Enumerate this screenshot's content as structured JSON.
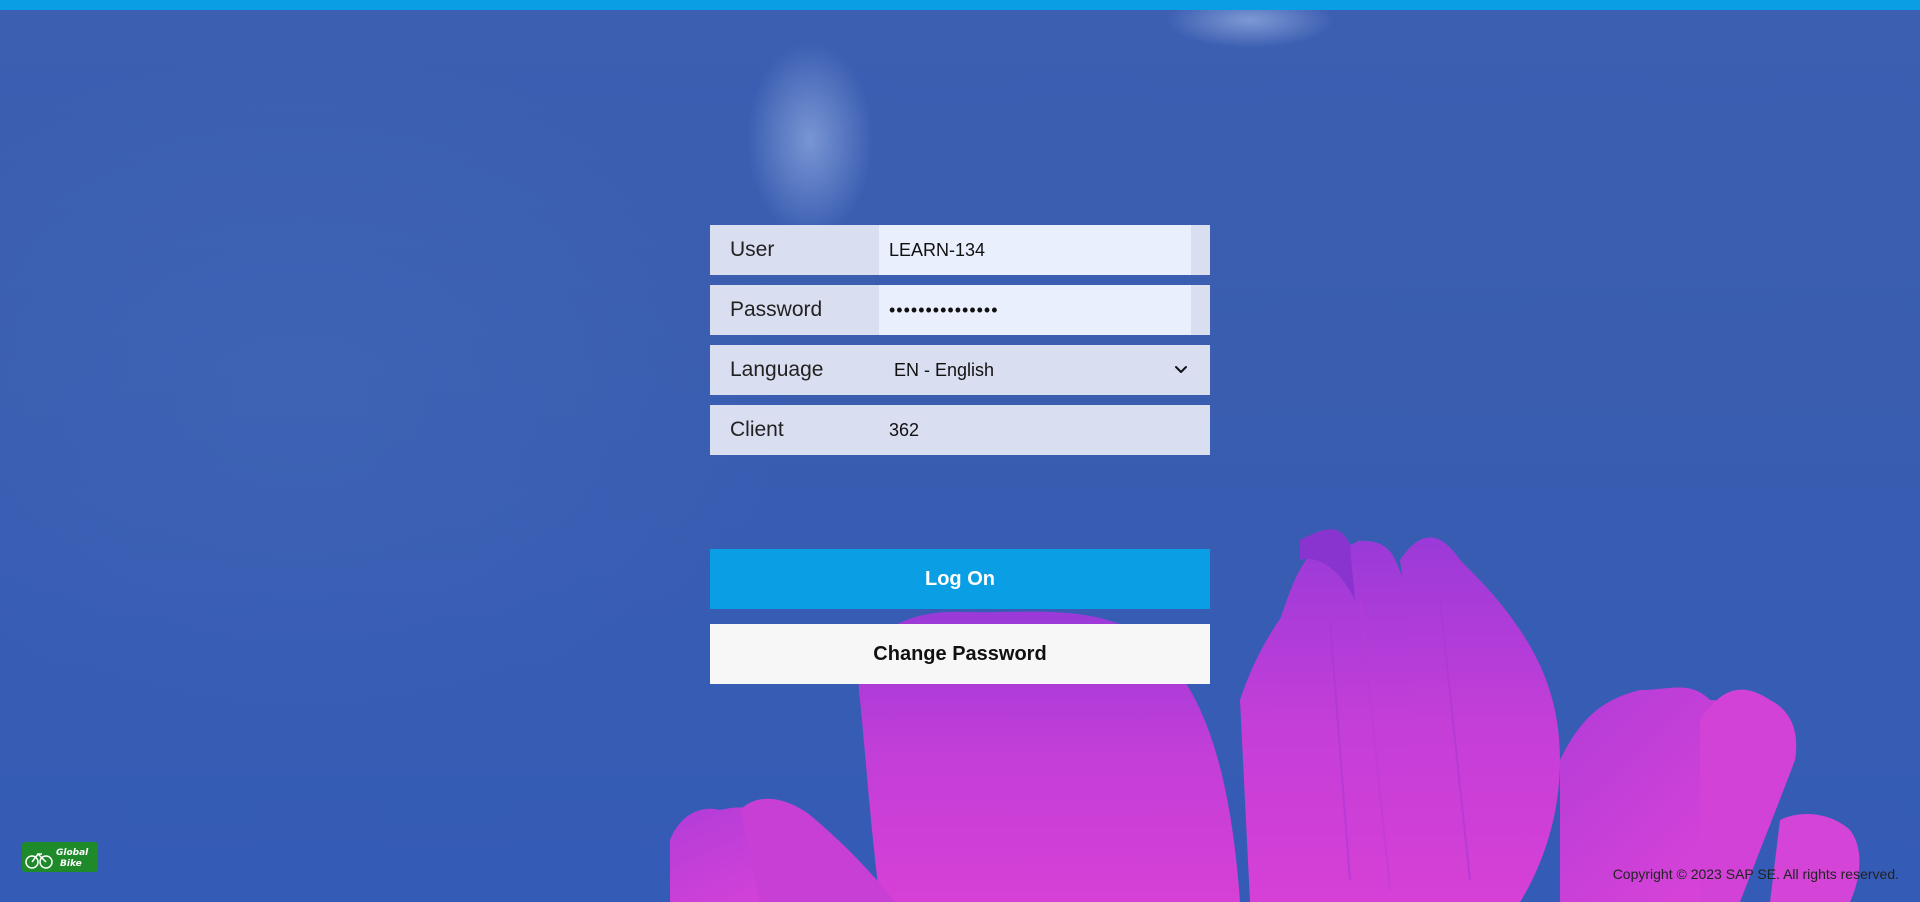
{
  "colors": {
    "accent": "#0a9fe4",
    "background": "#3a5fb0",
    "field_bg": "#d9def0",
    "input_bg": "#eaeffd",
    "secondary_button_bg": "#f7f7f7",
    "flower": "#c63dd6"
  },
  "form": {
    "user": {
      "label": "User",
      "value": "LEARN-134"
    },
    "password": {
      "label": "Password",
      "value": "•••••••••••••••"
    },
    "language": {
      "label": "Language",
      "value": "EN - English",
      "icon": "chevron-down-icon"
    },
    "client": {
      "label": "Client",
      "value": "362"
    }
  },
  "buttons": {
    "logon": "Log On",
    "change_password": "Change Password"
  },
  "footer": {
    "copyright": "Copyright © 2023 SAP SE. All rights reserved.",
    "logo_text": "Global Bike"
  }
}
